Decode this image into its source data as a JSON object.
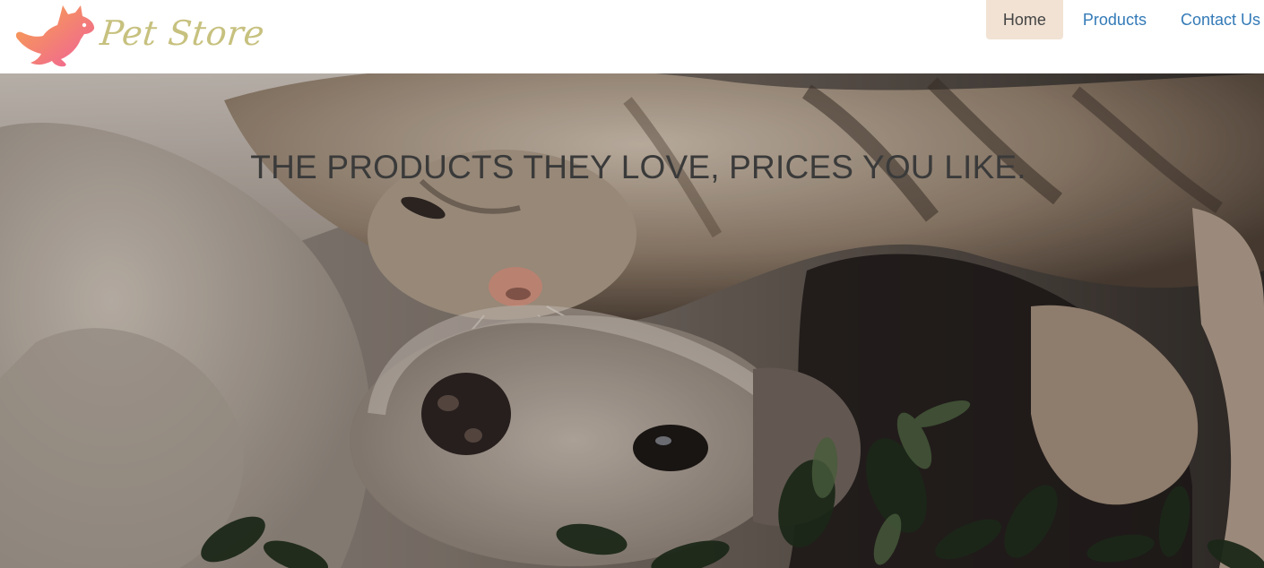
{
  "brand": {
    "name": "Pet Store",
    "logo_icon": "running-pet-icon",
    "colors": {
      "logo_gradient_start": "#f79a4a",
      "logo_gradient_end": "#f0609a",
      "text": "#c7c17f"
    }
  },
  "nav": {
    "items": [
      {
        "label": "Home",
        "active": true
      },
      {
        "label": "Products",
        "active": false
      },
      {
        "label": "Contact Us",
        "active": false
      }
    ],
    "colors": {
      "link": "#337ab7",
      "active_bg": "#f1e2d3",
      "active_text": "#444444"
    }
  },
  "hero": {
    "headline": "THE PRODUCTS THEY LOVE, PRICES YOU LIKE.",
    "image": "cat-and-dog-photo"
  }
}
